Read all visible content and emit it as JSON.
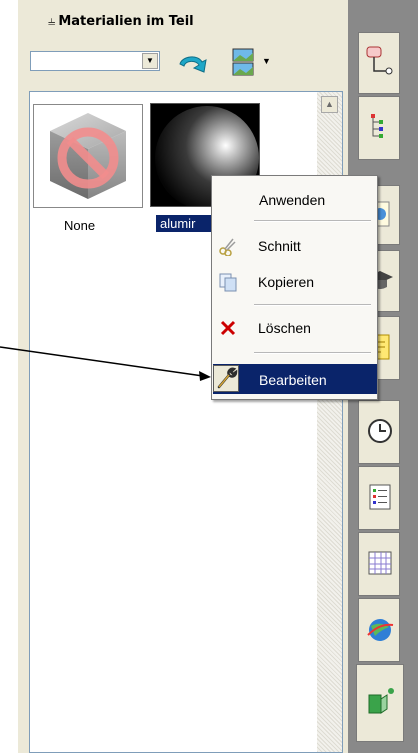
{
  "panel": {
    "title": "Materialien im Teil",
    "pin_icon": "pin-icon",
    "combo_value": "",
    "undo_icon": "undo-arrow-icon",
    "image_icon": "image-icon",
    "dropdown_icon": "chevron-down-icon"
  },
  "materials": [
    {
      "label": "None",
      "icon": "no-material-icon"
    },
    {
      "label": "alumir",
      "icon": "aluminium-sphere-icon",
      "selected": true
    }
  ],
  "context_menu": {
    "items": [
      {
        "label": "Anwenden",
        "icon": ""
      },
      {
        "label": "Schnitt",
        "icon": "cut-icon"
      },
      {
        "label": "Kopieren",
        "icon": "copy-icon"
      },
      {
        "label": "Löschen",
        "icon": "delete-icon"
      },
      {
        "label": "Bearbeiten",
        "icon": "wrench-icon",
        "highlighted": true
      }
    ]
  },
  "sidebar_tabs": [
    "feature-manager-icon",
    "tree-icon",
    "document-icon",
    "graduation-cap-icon",
    "note-icon",
    "clock-icon",
    "list-icon",
    "table-icon",
    "globe-icon",
    "appearance-icon"
  ],
  "colors": {
    "panel_bg": "#ece9d8",
    "selection": "#0a246a",
    "sidebar_bg": "#898989",
    "delete_red": "#cc0000"
  }
}
